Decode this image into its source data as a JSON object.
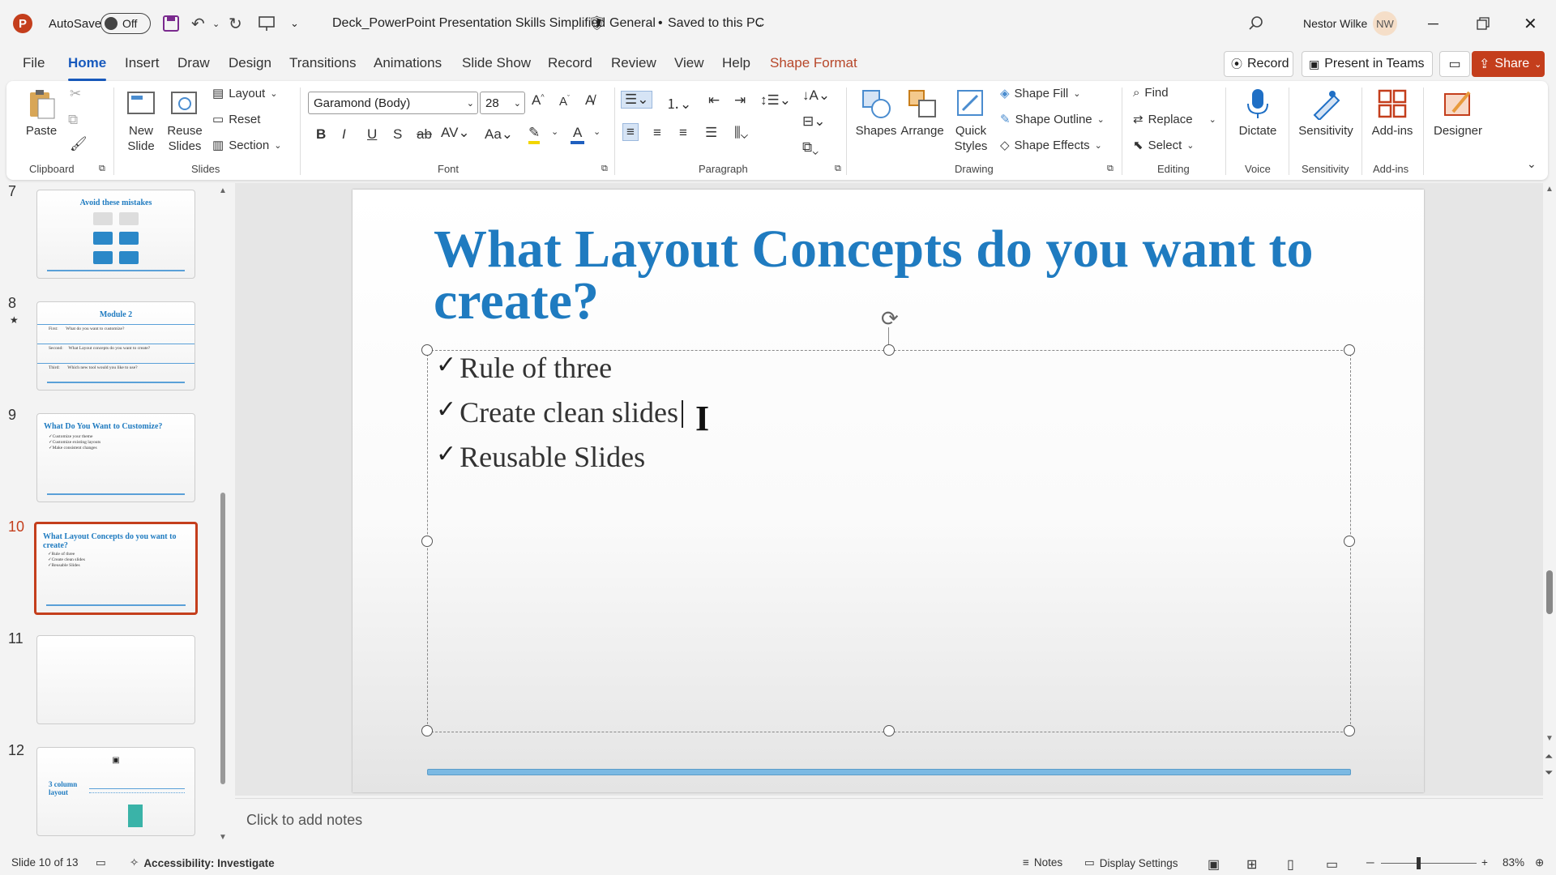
{
  "titlebar": {
    "app_logo": "P",
    "autosave_label": "AutoSave",
    "autosave_state": "Off",
    "document_title": "Deck_PowerPoint Presentation Skills Simplified",
    "sensitivity": "General",
    "save_status": "Saved to this PC",
    "user_name": "Nestor Wilke",
    "user_initials": "NW"
  },
  "menu": {
    "tabs": [
      "File",
      "Home",
      "Insert",
      "Draw",
      "Design",
      "Transitions",
      "Animations",
      "Slide Show",
      "Record",
      "Review",
      "View",
      "Help",
      "Shape Format"
    ],
    "active": "Home",
    "record_label": "Record",
    "present_teams_label": "Present in Teams",
    "share_label": "Share"
  },
  "ribbon": {
    "clipboard": {
      "paste": "Paste",
      "group": "Clipboard"
    },
    "slides": {
      "new_slide": "New Slide",
      "reuse_slides": "Reuse Slides",
      "layout": "Layout",
      "reset": "Reset",
      "section": "Section",
      "group": "Slides"
    },
    "font": {
      "family": "Garamond (Body)",
      "size": "28",
      "group": "Font"
    },
    "paragraph": {
      "group": "Paragraph"
    },
    "drawing": {
      "shapes": "Shapes",
      "arrange": "Arrange",
      "quick_styles": "Quick Styles",
      "shape_fill": "Shape Fill",
      "shape_outline": "Shape Outline",
      "shape_effects": "Shape Effects",
      "group": "Drawing"
    },
    "editing": {
      "find": "Find",
      "replace": "Replace",
      "select": "Select",
      "group": "Editing"
    },
    "voice": {
      "dictate": "Dictate",
      "group": "Voice"
    },
    "sensitivity": {
      "label": "Sensitivity",
      "group": "Sensitivity"
    },
    "addins": {
      "label": "Add-ins",
      "group": "Add-ins"
    },
    "designer": {
      "label": "Designer"
    }
  },
  "thumbnails": [
    {
      "num": "7",
      "title": "Avoid these mistakes"
    },
    {
      "num": "8",
      "title": "Module 2",
      "rows": [
        [
          "First:",
          "What do you want to customize?"
        ],
        [
          "Second:",
          "What Layout concepts do you want to create?"
        ],
        [
          "Third:",
          "Which new tool would you like to use?"
        ]
      ]
    },
    {
      "num": "9",
      "title": "What Do You Want to Customize?",
      "bullets": [
        "✓Customize your theme",
        "✓Customize existing layouts",
        "✓Make consistent changes"
      ]
    },
    {
      "num": "10",
      "title": "What Layout Concepts do you want to create?",
      "bullets": [
        "✓Rule of three",
        "✓Create clean slides",
        "✓Reusable Slides"
      ]
    },
    {
      "num": "11"
    },
    {
      "num": "12",
      "side_label": "3 column layout"
    }
  ],
  "slide": {
    "title": "What Layout Concepts do you want to create?",
    "bullets": [
      "Rule of three",
      "Create clean slides",
      "Reusable Slides"
    ],
    "bullet_glyph": "✓"
  },
  "notes_placeholder": "Click to add notes",
  "status": {
    "slide_counter": "Slide 10 of 13",
    "accessibility": "Accessibility: Investigate",
    "notes": "Notes",
    "display_settings": "Display Settings",
    "zoom": "83%"
  },
  "colors": {
    "accent": "#c43e1c",
    "title_blue": "#1f7bc0",
    "tab_blue": "#185abd"
  }
}
